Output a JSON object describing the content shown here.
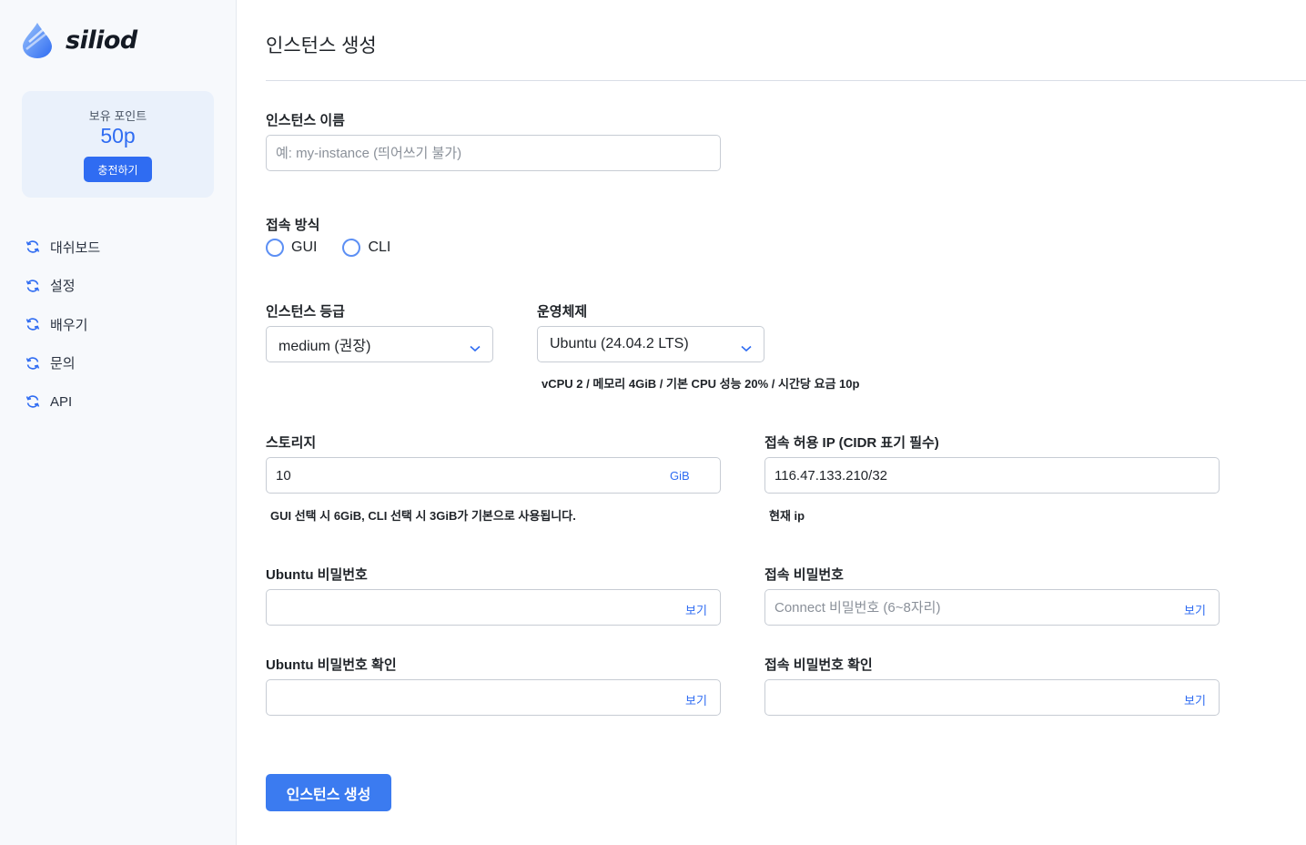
{
  "brand": {
    "name": "siliod"
  },
  "points": {
    "label": "보유 포인트",
    "value": "50p",
    "charge_label": "충전하기"
  },
  "nav": [
    {
      "label": "대쉬보드",
      "icon": "refresh-icon"
    },
    {
      "label": "설정",
      "icon": "refresh-icon"
    },
    {
      "label": "배우기",
      "icon": "refresh-icon"
    },
    {
      "label": "문의",
      "icon": "refresh-icon"
    },
    {
      "label": "API",
      "icon": "refresh-icon"
    }
  ],
  "page": {
    "title": "인스턴스 생성"
  },
  "form": {
    "instance_name": {
      "label": "인스턴스 이름",
      "placeholder": "예: my-instance (띄어쓰기 불가)",
      "value": ""
    },
    "access_method": {
      "label": "접속 방식",
      "options": [
        "GUI",
        "CLI"
      ]
    },
    "instance_grade": {
      "label": "인스턴스 등급",
      "selected": "medium (권장)"
    },
    "os": {
      "label": "운영체제",
      "selected": "Ubuntu (24.04.2 LTS)"
    },
    "spec_text": "vCPU 2 / 메모리 4GiB / 기본 CPU 성능 20% / 시간당 요금 10p",
    "storage": {
      "label": "스토리지",
      "value": "10",
      "unit": "GiB",
      "helper": "GUI 선택 시 6GiB, CLI 선택 시 3GiB가 기본으로 사용됩니다."
    },
    "allowed_ip": {
      "label": "접속 허용 IP (CIDR 표기 필수)",
      "value": "116.47.133.210/32",
      "helper": "현재 ip"
    },
    "ubuntu_password": {
      "label": "Ubuntu 비밀번호",
      "placeholder": "",
      "show_label": "보기"
    },
    "connect_password": {
      "label": "접속 비밀번호",
      "placeholder": "Connect 비밀번호 (6~8자리)",
      "show_label": "보기"
    },
    "ubuntu_password_confirm": {
      "label": "Ubuntu 비밀번호 확인",
      "placeholder": "",
      "show_label": "보기"
    },
    "connect_password_confirm": {
      "label": "접속 비밀번호 확인",
      "placeholder": "",
      "show_label": "보기"
    },
    "submit_label": "인스턴스 생성"
  },
  "colors": {
    "accent": "#2f6cf2",
    "sidebar_bg": "#f7f9fc",
    "points_card_bg": "#eaf1fb"
  }
}
